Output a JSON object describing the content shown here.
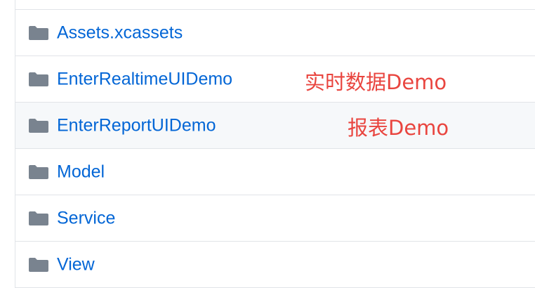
{
  "file_list": {
    "items": [
      {
        "name": ""
      },
      {
        "name": "Assets.xcassets"
      },
      {
        "name": "EnterRealtimeUIDemo",
        "annotation": "实时数据Demo"
      },
      {
        "name": "EnterReportUIDemo",
        "annotation": "报表Demo"
      },
      {
        "name": "Model"
      },
      {
        "name": "Service"
      },
      {
        "name": "View"
      }
    ]
  },
  "colors": {
    "link": "#0366d6",
    "folder_icon": "#79838f",
    "annotation": "#e9453f",
    "row_border": "#e1e4e8",
    "hover_row": "#f6f8fa"
  },
  "icons": {
    "folder": "folder-icon"
  }
}
